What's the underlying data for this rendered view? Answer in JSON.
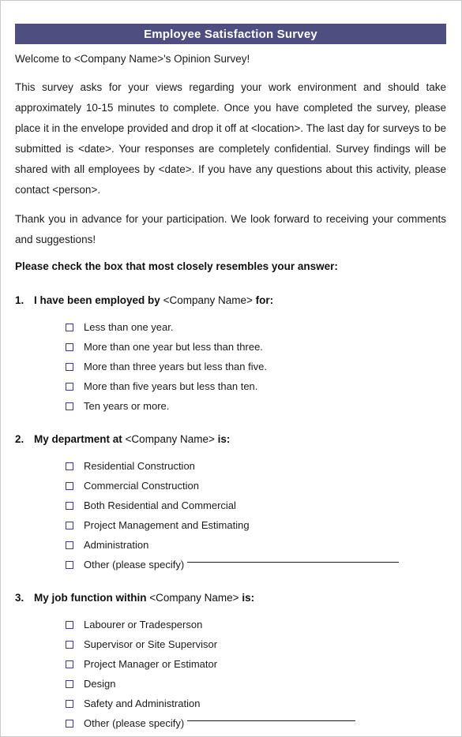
{
  "document": {
    "title": "Employee Satisfaction Survey",
    "welcome": "Welcome to <Company Name>'s Opinion Survey!",
    "intro_paragraph": "This survey asks for your views regarding your work environment and should take approximately 10-15 minutes to complete.  Once you have completed the survey, please place it in the envelope provided and drop it off at <location>.  The last day for surveys to be submitted is <date>.  Your responses are completely confidential.  Survey findings will be shared with all employees by <date>.  If you have any questions about this activity, please contact <person>.",
    "thanks_paragraph": "Thank you in advance for your participation.  We look forward to receiving your comments and suggestions!",
    "instruction": "Please check the box that most closely resembles your answer:",
    "header_color": "#4f4e80",
    "checkbox_color": "#3b39a0"
  },
  "questions": [
    {
      "number": "1.",
      "prompt_bold_1": "I have been employed by",
      "prompt_plain": "<Company Name>",
      "prompt_bold_2": "for:",
      "options": [
        {
          "label": "Less than one year.",
          "has_line": false
        },
        {
          "label": "More than one year but less than three.",
          "has_line": false
        },
        {
          "label": "More than three years but less than five.",
          "has_line": false
        },
        {
          "label": "More than five years but less than ten.",
          "has_line": false
        },
        {
          "label": "Ten years or more.",
          "has_line": false
        }
      ]
    },
    {
      "number": "2.",
      "prompt_bold_1": "My department at",
      "prompt_plain": "<Company Name>",
      "prompt_bold_2": "is:",
      "options": [
        {
          "label": "Residential Construction",
          "has_line": false
        },
        {
          "label": "Commercial Construction",
          "has_line": false
        },
        {
          "label": "Both Residential and Commercial",
          "has_line": false
        },
        {
          "label": "Project Management and Estimating",
          "has_line": false
        },
        {
          "label": "Administration",
          "has_line": false
        },
        {
          "label": "Other (please specify)",
          "has_line": true,
          "line_length": "long"
        }
      ]
    },
    {
      "number": "3.",
      "prompt_bold_1": "My job function within",
      "prompt_plain": "<Company Name>",
      "prompt_bold_2": "is:",
      "options": [
        {
          "label": "Labourer or Tradesperson",
          "has_line": false
        },
        {
          "label": "Supervisor or Site Supervisor",
          "has_line": false
        },
        {
          "label": "Project Manager or Estimator",
          "has_line": false
        },
        {
          "label": "Design",
          "has_line": false
        },
        {
          "label": "Safety and Administration",
          "has_line": false
        },
        {
          "label": "Other (please specify)",
          "has_line": true,
          "line_length": "short"
        }
      ]
    }
  ]
}
